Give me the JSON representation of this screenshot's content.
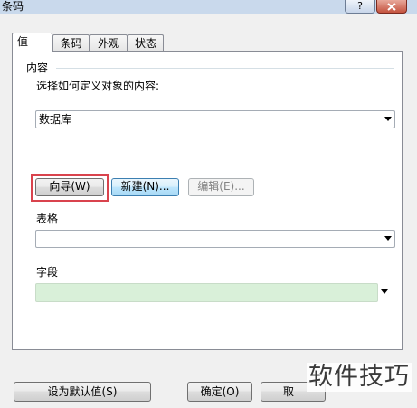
{
  "window": {
    "title": "条码"
  },
  "tabs": [
    {
      "label": "值",
      "active": true
    },
    {
      "label": "条码",
      "active": false
    },
    {
      "label": "外观",
      "active": false
    },
    {
      "label": "状态",
      "active": false
    }
  ],
  "content": {
    "group_label": "内容",
    "prompt": "选择如何定义对象的内容:",
    "source_value": "数据库",
    "buttons": {
      "wizard": "向导(W)",
      "new": "新建(N)...",
      "edit": "编辑(E)..."
    },
    "table_label": "表格",
    "table_value": "",
    "field_label": "字段",
    "field_value": ""
  },
  "footer": {
    "set_default": "设为默认值(S)",
    "ok": "确定(O)",
    "cancel_partial": "取"
  },
  "watermark": "软件技巧",
  "colors": {
    "highlight_box": "#d9434d",
    "field_fill": "#d9f0d9",
    "focused_button": "#a7d9f5"
  }
}
